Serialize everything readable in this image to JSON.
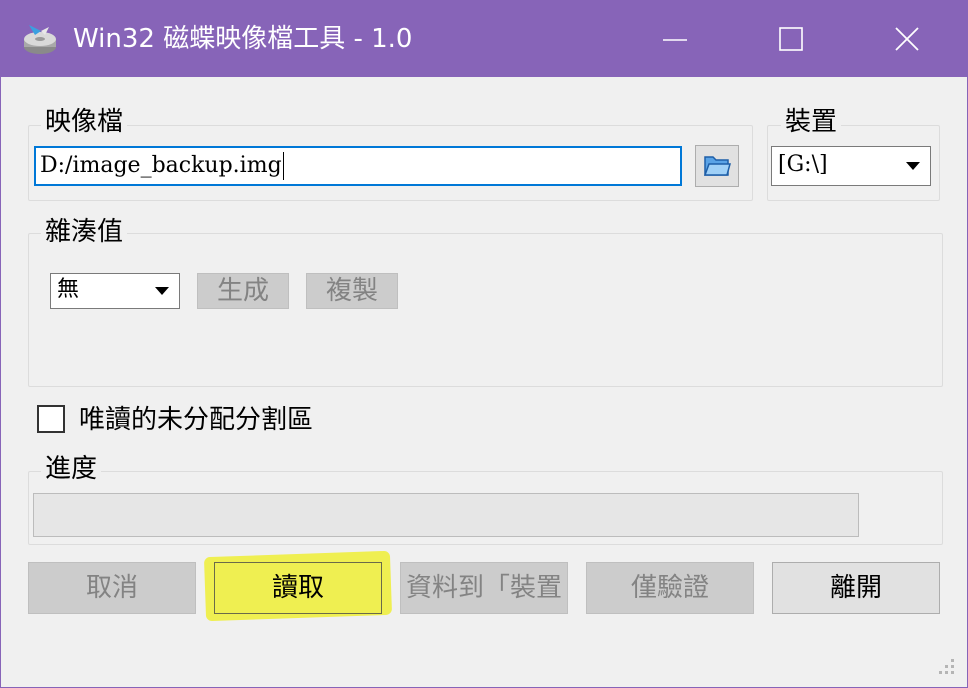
{
  "window": {
    "title": "Win32 磁蝶映像檔工具 - 1.0",
    "icon": "disk-imager-icon",
    "controls": [
      "minimize-icon",
      "maximize-icon",
      "close-icon"
    ]
  },
  "image_file": {
    "label": "映像檔",
    "value": "D:/image_backup.img",
    "browse_icon": "folder-open-icon"
  },
  "device": {
    "label": "裝置",
    "selected": "[G:\\]"
  },
  "hash": {
    "label": "雜湊值",
    "selected": "無",
    "generate_label": "生成",
    "copy_label": "複製"
  },
  "options": {
    "read_only_allocated_label": "唯讀的未分配分割區",
    "read_only_allocated_checked": false
  },
  "progress": {
    "label": "進度",
    "value": 0
  },
  "actions": {
    "cancel_label": "取消",
    "read_label": "讀取",
    "write_label": "資料到「裝置",
    "verify_label": "僅驗證",
    "exit_label": "離開"
  },
  "colors": {
    "titlebar": "#8764b8",
    "focus_border": "#0078d7",
    "highlight": "#eeee14"
  }
}
